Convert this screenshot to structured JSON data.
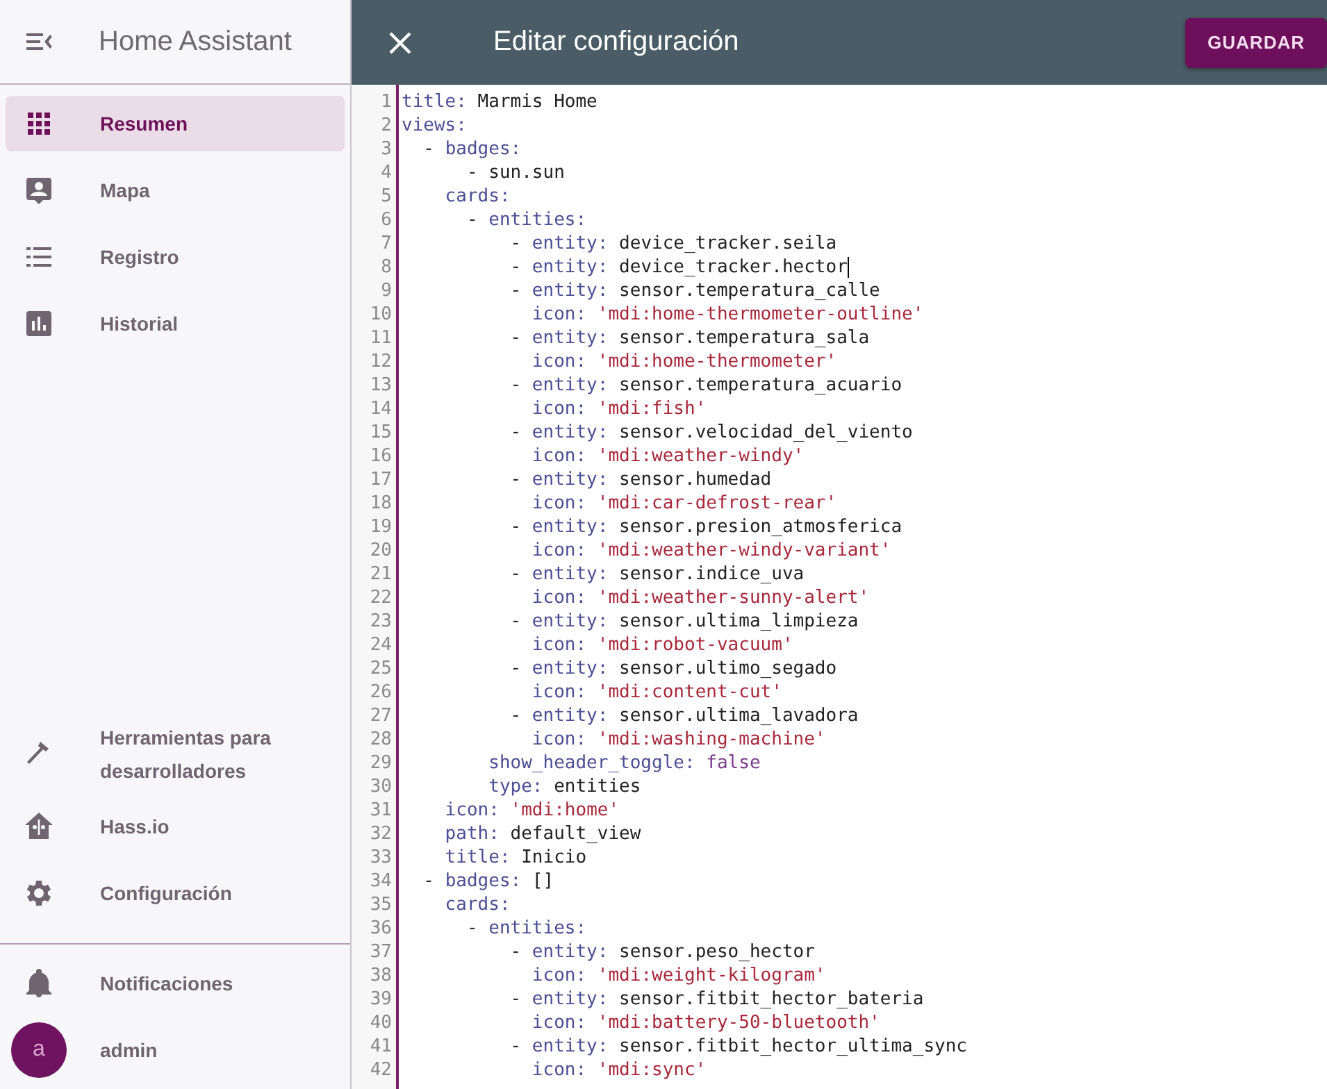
{
  "sidebar": {
    "title": "Home Assistant",
    "items": [
      {
        "label": "Resumen",
        "selected": true
      },
      {
        "label": "Mapa",
        "selected": false
      },
      {
        "label": "Registro",
        "selected": false
      },
      {
        "label": "Historial",
        "selected": false
      }
    ],
    "bottom_items": [
      {
        "label": "Herramientas para desarrolladores",
        "selected": false
      },
      {
        "label": "Hass.io",
        "selected": false
      },
      {
        "label": "Configuración",
        "selected": false
      }
    ],
    "notifications": "Notificaciones",
    "user": {
      "initial": "a",
      "name": "admin"
    }
  },
  "dialog": {
    "title": "Editar configuración",
    "save_button": "GUARDAR"
  },
  "editor": {
    "lines": [
      {
        "num": "1",
        "cursor": false,
        "segments": [
          {
            "kind": "key",
            "text": "title:"
          },
          {
            "kind": "plain",
            "text": " Marmis Home"
          }
        ]
      },
      {
        "num": "2",
        "cursor": false,
        "segments": [
          {
            "kind": "key",
            "text": "views:"
          }
        ]
      },
      {
        "num": "3",
        "cursor": false,
        "segments": [
          {
            "kind": "plain",
            "text": "  - "
          },
          {
            "kind": "key",
            "text": "badges:"
          }
        ]
      },
      {
        "num": "4",
        "cursor": false,
        "segments": [
          {
            "kind": "plain",
            "text": "      - sun.sun"
          }
        ]
      },
      {
        "num": "5",
        "cursor": false,
        "segments": [
          {
            "kind": "key",
            "text": "    cards:"
          }
        ]
      },
      {
        "num": "6",
        "cursor": false,
        "segments": [
          {
            "kind": "plain",
            "text": "      - "
          },
          {
            "kind": "key",
            "text": "entities:"
          }
        ]
      },
      {
        "num": "7",
        "cursor": false,
        "segments": [
          {
            "kind": "plain",
            "text": "          - "
          },
          {
            "kind": "key",
            "text": "entity:"
          },
          {
            "kind": "plain",
            "text": " device_tracker.seila"
          }
        ]
      },
      {
        "num": "8",
        "cursor": true,
        "segments": [
          {
            "kind": "plain",
            "text": "          - "
          },
          {
            "kind": "key",
            "text": "entity:"
          },
          {
            "kind": "plain",
            "text": " device_tracker.hector"
          }
        ]
      },
      {
        "num": "9",
        "cursor": false,
        "segments": [
          {
            "kind": "plain",
            "text": "          - "
          },
          {
            "kind": "key",
            "text": "entity:"
          },
          {
            "kind": "plain",
            "text": " sensor.temperatura_calle"
          }
        ]
      },
      {
        "num": "10",
        "cursor": false,
        "segments": [
          {
            "kind": "key",
            "text": "            icon:"
          },
          {
            "kind": "string",
            "text": " 'mdi:home-thermometer-outline'"
          }
        ]
      },
      {
        "num": "11",
        "cursor": false,
        "segments": [
          {
            "kind": "plain",
            "text": "          - "
          },
          {
            "kind": "key",
            "text": "entity:"
          },
          {
            "kind": "plain",
            "text": " sensor.temperatura_sala"
          }
        ]
      },
      {
        "num": "12",
        "cursor": false,
        "segments": [
          {
            "kind": "key",
            "text": "            icon:"
          },
          {
            "kind": "string",
            "text": " 'mdi:home-thermometer'"
          }
        ]
      },
      {
        "num": "13",
        "cursor": false,
        "segments": [
          {
            "kind": "plain",
            "text": "          - "
          },
          {
            "kind": "key",
            "text": "entity:"
          },
          {
            "kind": "plain",
            "text": " sensor.temperatura_acuario"
          }
        ]
      },
      {
        "num": "14",
        "cursor": false,
        "segments": [
          {
            "kind": "key",
            "text": "            icon:"
          },
          {
            "kind": "string",
            "text": " 'mdi:fish'"
          }
        ]
      },
      {
        "num": "15",
        "cursor": false,
        "segments": [
          {
            "kind": "plain",
            "text": "          - "
          },
          {
            "kind": "key",
            "text": "entity:"
          },
          {
            "kind": "plain",
            "text": " sensor.velocidad_del_viento"
          }
        ]
      },
      {
        "num": "16",
        "cursor": false,
        "segments": [
          {
            "kind": "key",
            "text": "            icon:"
          },
          {
            "kind": "string",
            "text": " 'mdi:weather-windy'"
          }
        ]
      },
      {
        "num": "17",
        "cursor": false,
        "segments": [
          {
            "kind": "plain",
            "text": "          - "
          },
          {
            "kind": "key",
            "text": "entity:"
          },
          {
            "kind": "plain",
            "text": " sensor.humedad"
          }
        ]
      },
      {
        "num": "18",
        "cursor": false,
        "segments": [
          {
            "kind": "key",
            "text": "            icon:"
          },
          {
            "kind": "string",
            "text": " 'mdi:car-defrost-rear'"
          }
        ]
      },
      {
        "num": "19",
        "cursor": false,
        "segments": [
          {
            "kind": "plain",
            "text": "          - "
          },
          {
            "kind": "key",
            "text": "entity:"
          },
          {
            "kind": "plain",
            "text": " sensor.presion_atmosferica"
          }
        ]
      },
      {
        "num": "20",
        "cursor": false,
        "segments": [
          {
            "kind": "key",
            "text": "            icon:"
          },
          {
            "kind": "string",
            "text": " 'mdi:weather-windy-variant'"
          }
        ]
      },
      {
        "num": "21",
        "cursor": false,
        "segments": [
          {
            "kind": "plain",
            "text": "          - "
          },
          {
            "kind": "key",
            "text": "entity:"
          },
          {
            "kind": "plain",
            "text": " sensor.indice_uva"
          }
        ]
      },
      {
        "num": "22",
        "cursor": false,
        "segments": [
          {
            "kind": "key",
            "text": "            icon:"
          },
          {
            "kind": "string",
            "text": " 'mdi:weather-sunny-alert'"
          }
        ]
      },
      {
        "num": "23",
        "cursor": false,
        "segments": [
          {
            "kind": "plain",
            "text": "          - "
          },
          {
            "kind": "key",
            "text": "entity:"
          },
          {
            "kind": "plain",
            "text": " sensor.ultima_limpieza"
          }
        ]
      },
      {
        "num": "24",
        "cursor": false,
        "segments": [
          {
            "kind": "key",
            "text": "            icon:"
          },
          {
            "kind": "string",
            "text": " 'mdi:robot-vacuum'"
          }
        ]
      },
      {
        "num": "25",
        "cursor": false,
        "segments": [
          {
            "kind": "plain",
            "text": "          - "
          },
          {
            "kind": "key",
            "text": "entity:"
          },
          {
            "kind": "plain",
            "text": " sensor.ultimo_segado"
          }
        ]
      },
      {
        "num": "26",
        "cursor": false,
        "segments": [
          {
            "kind": "key",
            "text": "            icon:"
          },
          {
            "kind": "string",
            "text": " 'mdi:content-cut'"
          }
        ]
      },
      {
        "num": "27",
        "cursor": false,
        "segments": [
          {
            "kind": "plain",
            "text": "          - "
          },
          {
            "kind": "key",
            "text": "entity:"
          },
          {
            "kind": "plain",
            "text": " sensor.ultima_lavadora"
          }
        ]
      },
      {
        "num": "28",
        "cursor": false,
        "segments": [
          {
            "kind": "key",
            "text": "            icon:"
          },
          {
            "kind": "string",
            "text": " 'mdi:washing-machine'"
          }
        ]
      },
      {
        "num": "29",
        "cursor": false,
        "segments": [
          {
            "kind": "key",
            "text": "        show_header_toggle:"
          },
          {
            "kind": "bool",
            "text": " false"
          }
        ]
      },
      {
        "num": "30",
        "cursor": false,
        "segments": [
          {
            "kind": "key",
            "text": "        type:"
          },
          {
            "kind": "plain",
            "text": " entities"
          }
        ]
      },
      {
        "num": "31",
        "cursor": false,
        "segments": [
          {
            "kind": "key",
            "text": "    icon:"
          },
          {
            "kind": "string",
            "text": " 'mdi:home'"
          }
        ]
      },
      {
        "num": "32",
        "cursor": false,
        "segments": [
          {
            "kind": "key",
            "text": "    path:"
          },
          {
            "kind": "plain",
            "text": " default_view"
          }
        ]
      },
      {
        "num": "33",
        "cursor": false,
        "segments": [
          {
            "kind": "key",
            "text": "    title:"
          },
          {
            "kind": "plain",
            "text": " Inicio"
          }
        ]
      },
      {
        "num": "34",
        "cursor": false,
        "segments": [
          {
            "kind": "plain",
            "text": "  - "
          },
          {
            "kind": "key",
            "text": "badges:"
          },
          {
            "kind": "plain",
            "text": " []"
          }
        ]
      },
      {
        "num": "35",
        "cursor": false,
        "segments": [
          {
            "kind": "key",
            "text": "    cards:"
          }
        ]
      },
      {
        "num": "36",
        "cursor": false,
        "segments": [
          {
            "kind": "plain",
            "text": "      - "
          },
          {
            "kind": "key",
            "text": "entities:"
          }
        ]
      },
      {
        "num": "37",
        "cursor": false,
        "segments": [
          {
            "kind": "plain",
            "text": "          - "
          },
          {
            "kind": "key",
            "text": "entity:"
          },
          {
            "kind": "plain",
            "text": " sensor.peso_hector"
          }
        ]
      },
      {
        "num": "38",
        "cursor": false,
        "segments": [
          {
            "kind": "key",
            "text": "            icon:"
          },
          {
            "kind": "string",
            "text": " 'mdi:weight-kilogram'"
          }
        ]
      },
      {
        "num": "39",
        "cursor": false,
        "segments": [
          {
            "kind": "plain",
            "text": "          - "
          },
          {
            "kind": "key",
            "text": "entity:"
          },
          {
            "kind": "plain",
            "text": " sensor.fitbit_hector_bateria"
          }
        ]
      },
      {
        "num": "40",
        "cursor": false,
        "segments": [
          {
            "kind": "key",
            "text": "            icon:"
          },
          {
            "kind": "string",
            "text": " 'mdi:battery-50-bluetooth'"
          }
        ]
      },
      {
        "num": "41",
        "cursor": false,
        "segments": [
          {
            "kind": "plain",
            "text": "          - "
          },
          {
            "kind": "key",
            "text": "entity:"
          },
          {
            "kind": "plain",
            "text": " sensor.fitbit_hector_ultima_sync"
          }
        ]
      },
      {
        "num": "42",
        "cursor": false,
        "segments": [
          {
            "kind": "key",
            "text": "            icon:"
          },
          {
            "kind": "string",
            "text": " 'mdi:sync'"
          }
        ]
      }
    ]
  }
}
